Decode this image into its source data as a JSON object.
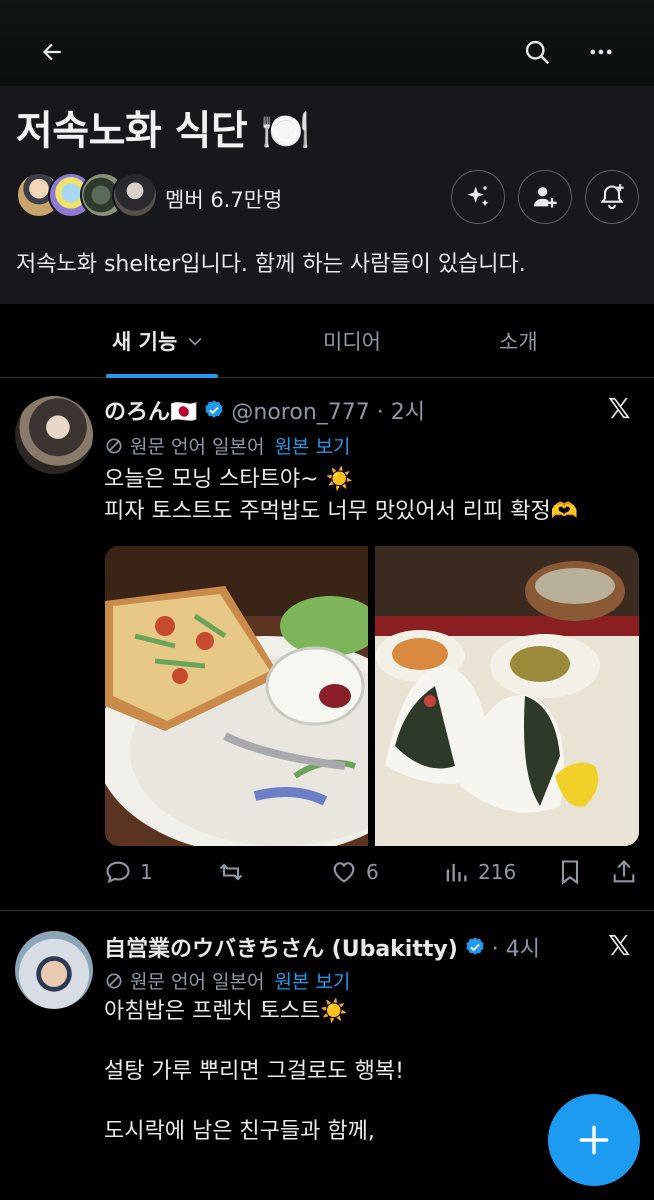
{
  "topbar": {
    "back_icon": "arrow-left-icon",
    "search_icon": "search-icon",
    "more_icon": "more-horizontal-icon"
  },
  "community": {
    "title": "저속노화 식단 🍽️",
    "members_label": "멤버 6.7만명",
    "description": "저속노화 shelter입니다. 함께 하는 사람들이 있습니다.",
    "action_icons": [
      "sparkle-icon",
      "add-user-icon",
      "bell-plus-icon"
    ]
  },
  "tabs": [
    {
      "label": "새 기능",
      "active": true,
      "icon": "chevron-down-icon"
    },
    {
      "label": "미디어",
      "active": false
    },
    {
      "label": "소개",
      "active": false
    }
  ],
  "posts": [
    {
      "display_name": "のろん🇯🇵",
      "handle_time": "@noron_777 · 2시",
      "verified": true,
      "translation_note": "원문 언어 일본어",
      "show_original": "원본 보기",
      "lines": [
        "오늘은 모닝 스타트야~ ☀️",
        "피자 토스트도 주먹밥도 너무 맛있어서 리피 확정🫶"
      ],
      "stats": {
        "replies": "1",
        "reposts": "",
        "likes": "6",
        "views": "216"
      }
    },
    {
      "display_name": "自営業のウバきちさん (Ubakitty)",
      "handle_time": "· 4시",
      "verified": true,
      "translation_note": "원문 언어 일본어",
      "show_original": "원본 보기",
      "lines": [
        "아침밥은 프렌치 토스트☀️",
        "",
        "설탕 가루 뿌리면 그걸로도 행복!",
        "",
        "도시락에 남은 친구들과 함께,"
      ]
    }
  ],
  "fab": {
    "icon": "plus-icon"
  },
  "colors": {
    "accent": "#1d9bf0",
    "background": "#000000",
    "header_bg": "#16181c",
    "muted": "#8b98a5"
  }
}
